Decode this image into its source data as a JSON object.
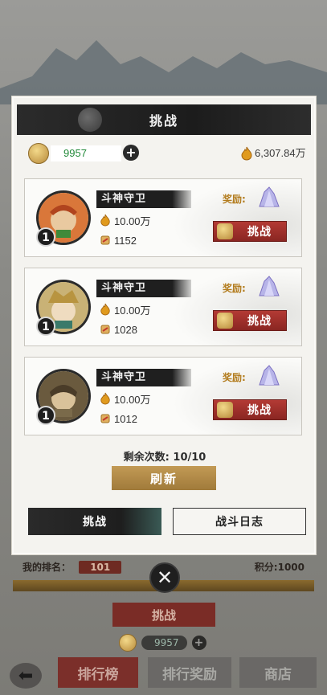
{
  "background": {
    "rank_label": "我的排名：",
    "rank_value": "101",
    "points": "积分:1000",
    "challenge_button": "挑战",
    "currency_value": "9957",
    "tabs": [
      "排行榜",
      "排行奖励",
      "商店"
    ]
  },
  "dialog": {
    "title": "挑战",
    "coin_value": "9957",
    "gold_value": "6,307.84万",
    "opponents": [
      {
        "name": "斗神守卫",
        "level": "1",
        "power": "10.00万",
        "score": "1152",
        "reward_label": "奖励:",
        "button": "挑战",
        "avatar_color": "#d9773a"
      },
      {
        "name": "斗神守卫",
        "level": "1",
        "power": "10.00万",
        "score": "1028",
        "reward_label": "奖励:",
        "button": "挑战",
        "avatar_color": "#c9b276"
      },
      {
        "name": "斗神守卫",
        "level": "1",
        "power": "10.00万",
        "score": "1012",
        "reward_label": "奖励:",
        "button": "挑战",
        "avatar_color": "#6a5a3e"
      }
    ],
    "remaining": "剩余次数: 10/10",
    "refresh_button": "刷新",
    "tabs": {
      "challenge": "挑战",
      "battle_log": "战斗日志"
    }
  },
  "colors": {
    "accent_red": "#8a2622",
    "gold": "#a07a3a",
    "coin_green": "#238a3a"
  }
}
